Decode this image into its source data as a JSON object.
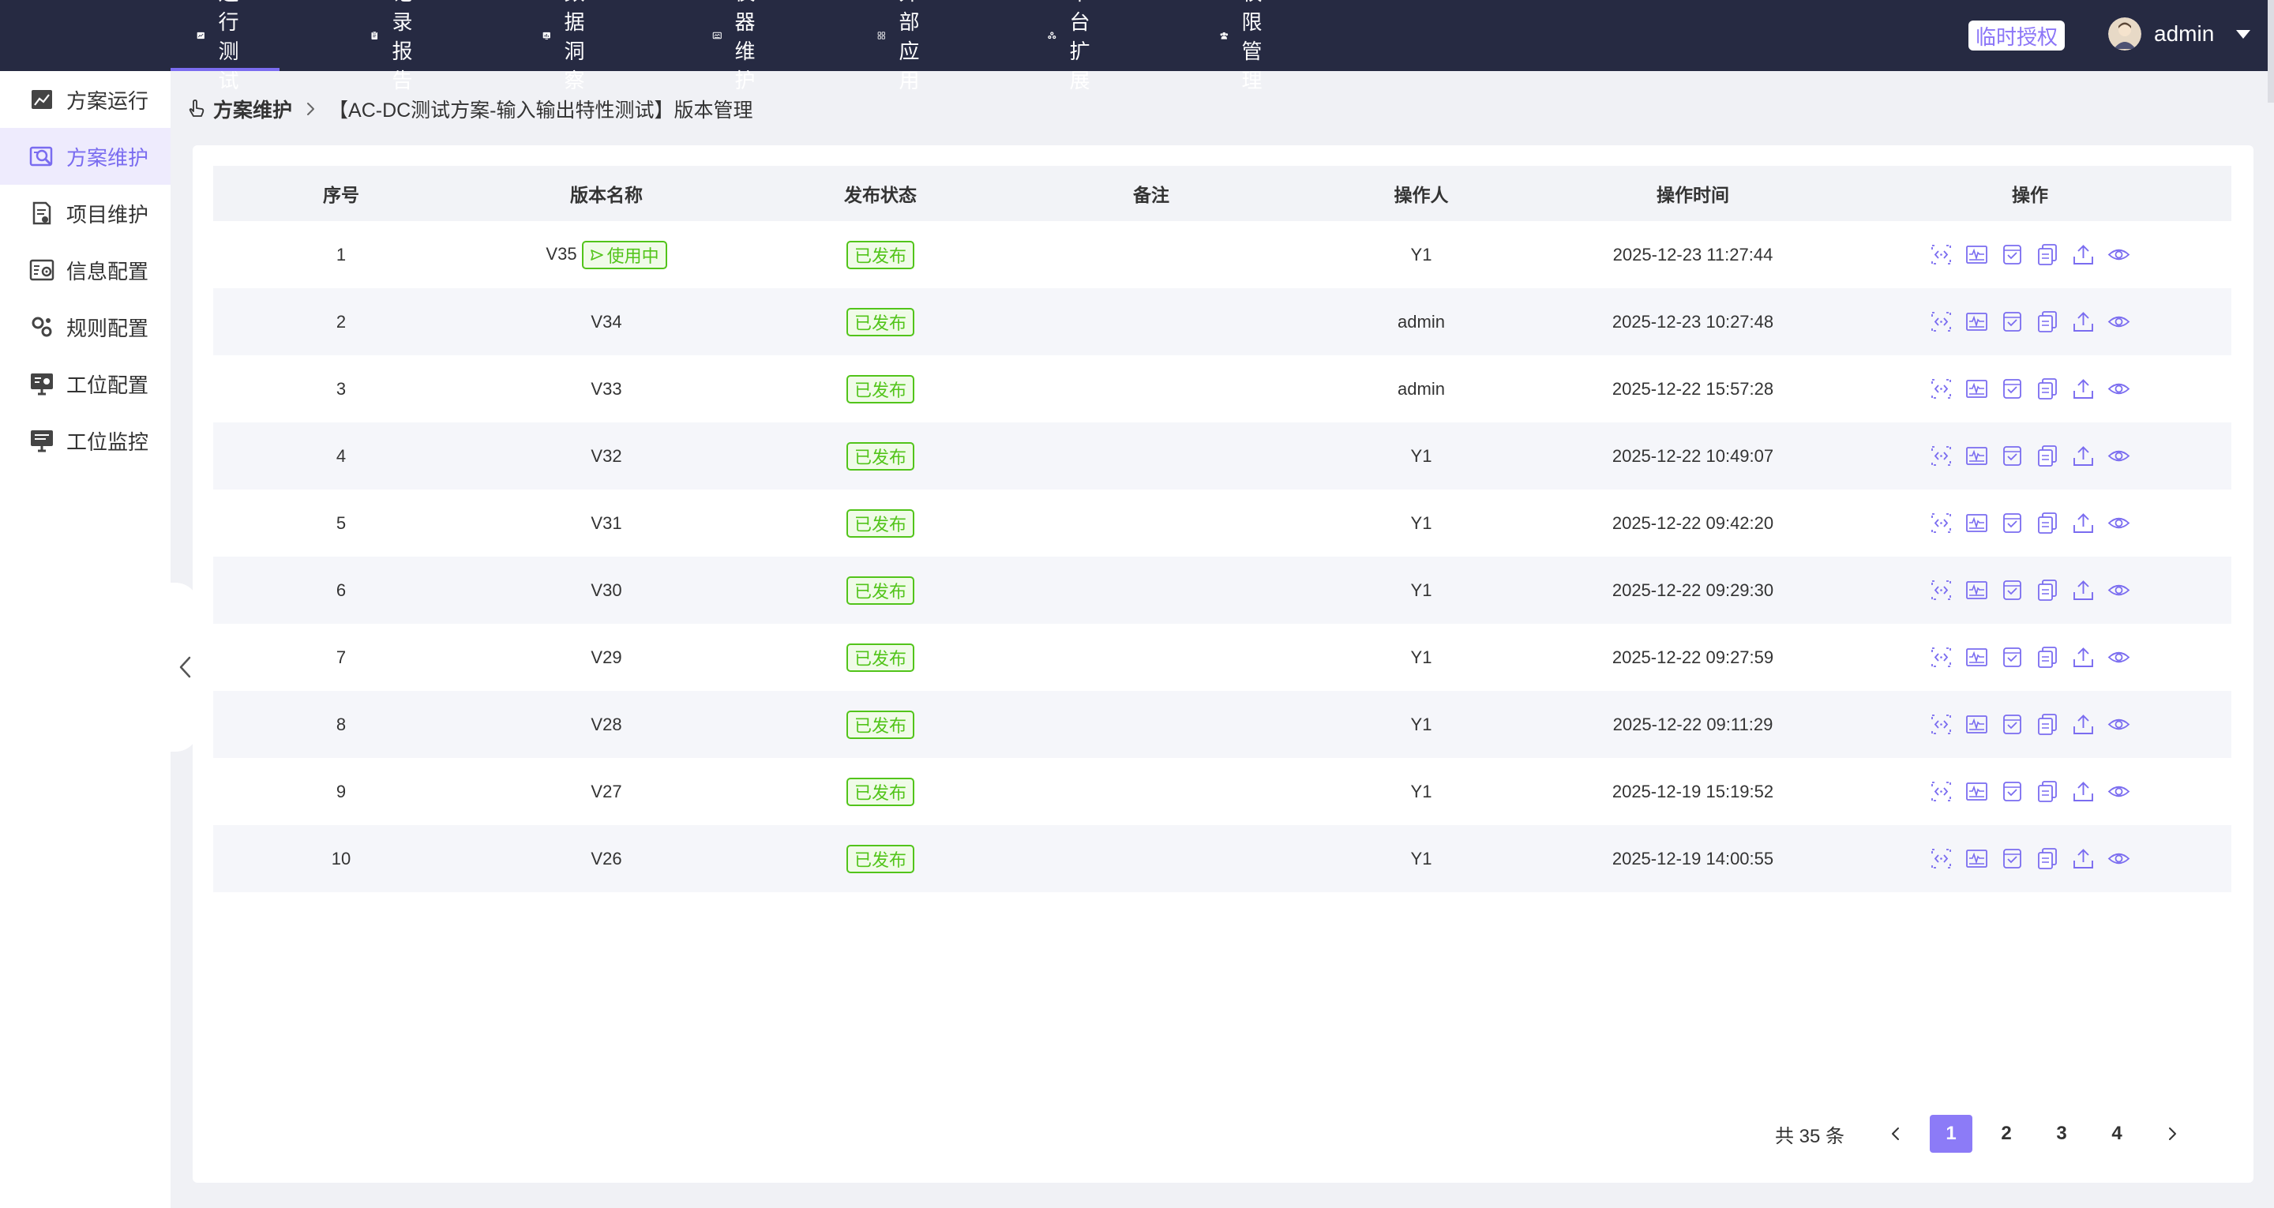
{
  "topnav": {
    "items": [
      {
        "label": "运行测试",
        "icon": "chart-board-icon",
        "active": true
      },
      {
        "label": "记录报告",
        "icon": "clipboard-icon",
        "active": false
      },
      {
        "label": "数据洞察",
        "icon": "bar-chart-icon",
        "active": false
      },
      {
        "label": "仪器维护",
        "icon": "instrument-icon",
        "active": false
      },
      {
        "label": "外部应用",
        "icon": "apps-grid-icon",
        "active": false
      },
      {
        "label": "平台扩展",
        "icon": "extension-icon",
        "active": false
      },
      {
        "label": "权限管理",
        "icon": "permission-icon",
        "active": false
      }
    ],
    "trial_badge": "临时授权",
    "user": "admin"
  },
  "sidebar": {
    "items": [
      {
        "label": "方案运行",
        "icon": "trend-chart-icon",
        "active": false
      },
      {
        "label": "方案维护",
        "icon": "search-chart-icon",
        "active": true
      },
      {
        "label": "项目维护",
        "icon": "document-edit-icon",
        "active": false
      },
      {
        "label": "信息配置",
        "icon": "info-settings-icon",
        "active": false
      },
      {
        "label": "规则配置",
        "icon": "gears-icon",
        "active": false
      },
      {
        "label": "工位配置",
        "icon": "workstation-settings-icon",
        "active": false
      },
      {
        "label": "工位监控",
        "icon": "monitor-icon",
        "active": false
      }
    ]
  },
  "breadcrumb": {
    "root": "方案维护",
    "current": "【AC-DC测试方案-输入输出特性测试】版本管理"
  },
  "table": {
    "headers": [
      "序号",
      "版本名称",
      "发布状态",
      "备注",
      "操作人",
      "操作时间",
      "操作"
    ],
    "in_use_label": "使用中",
    "rows": [
      {
        "index": "1",
        "version": "V35",
        "in_use": true,
        "status": "已发布",
        "remark": "",
        "operator": "Y1",
        "time": "2025-12-23 11:27:44"
      },
      {
        "index": "2",
        "version": "V34",
        "in_use": false,
        "status": "已发布",
        "remark": "",
        "operator": "admin",
        "time": "2025-12-23 10:27:48"
      },
      {
        "index": "3",
        "version": "V33",
        "in_use": false,
        "status": "已发布",
        "remark": "",
        "operator": "admin",
        "time": "2025-12-22 15:57:28"
      },
      {
        "index": "4",
        "version": "V32",
        "in_use": false,
        "status": "已发布",
        "remark": "",
        "operator": "Y1",
        "time": "2025-12-22 10:49:07"
      },
      {
        "index": "5",
        "version": "V31",
        "in_use": false,
        "status": "已发布",
        "remark": "",
        "operator": "Y1",
        "time": "2025-12-22 09:42:20"
      },
      {
        "index": "6",
        "version": "V30",
        "in_use": false,
        "status": "已发布",
        "remark": "",
        "operator": "Y1",
        "time": "2025-12-22 09:29:30"
      },
      {
        "index": "7",
        "version": "V29",
        "in_use": false,
        "status": "已发布",
        "remark": "",
        "operator": "Y1",
        "time": "2025-12-22 09:27:59"
      },
      {
        "index": "8",
        "version": "V28",
        "in_use": false,
        "status": "已发布",
        "remark": "",
        "operator": "Y1",
        "time": "2025-12-22 09:11:29"
      },
      {
        "index": "9",
        "version": "V27",
        "in_use": false,
        "status": "已发布",
        "remark": "",
        "operator": "Y1",
        "time": "2025-12-19 15:19:52"
      },
      {
        "index": "10",
        "version": "V26",
        "in_use": false,
        "status": "已发布",
        "remark": "",
        "operator": "Y1",
        "time": "2025-12-19 14:00:55"
      }
    ],
    "row_actions": [
      "code-icon",
      "waveform-icon",
      "check-doc-icon",
      "copy-icon",
      "upload-icon",
      "view-eye-icon"
    ]
  },
  "pagination": {
    "total_text": "共 35 条",
    "pages": [
      "1",
      "2",
      "3",
      "4"
    ],
    "current": "1"
  },
  "colors": {
    "topbar": "#262a42",
    "accent": "#8c7bf7",
    "published_green": "#52c41a"
  }
}
